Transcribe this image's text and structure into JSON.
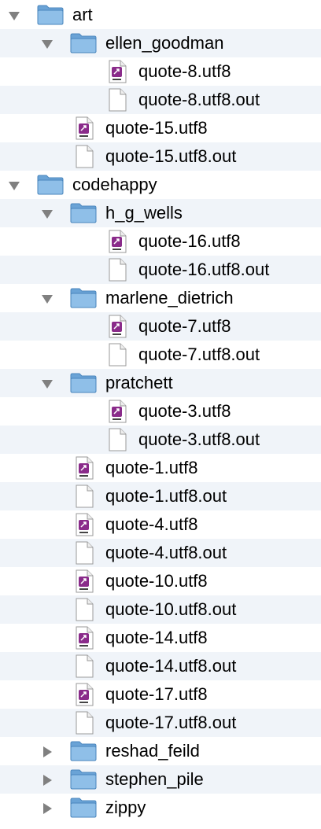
{
  "rows": [
    {
      "label": "art",
      "kind": "folder",
      "expanded": true,
      "depth": 0
    },
    {
      "label": "ellen_goodman",
      "kind": "folder",
      "expanded": true,
      "depth": 1
    },
    {
      "label": "quote-8.utf8",
      "kind": "text-file",
      "depth": 2
    },
    {
      "label": "quote-8.utf8.out",
      "kind": "blank-file",
      "depth": 2
    },
    {
      "label": "quote-15.utf8",
      "kind": "text-file",
      "depth": 1
    },
    {
      "label": "quote-15.utf8.out",
      "kind": "blank-file",
      "depth": 1
    },
    {
      "label": "codehappy",
      "kind": "folder",
      "expanded": true,
      "depth": 0
    },
    {
      "label": "h_g_wells",
      "kind": "folder",
      "expanded": true,
      "depth": 1
    },
    {
      "label": "quote-16.utf8",
      "kind": "text-file",
      "depth": 2
    },
    {
      "label": "quote-16.utf8.out",
      "kind": "blank-file",
      "depth": 2
    },
    {
      "label": "marlene_dietrich",
      "kind": "folder",
      "expanded": true,
      "depth": 1
    },
    {
      "label": "quote-7.utf8",
      "kind": "text-file",
      "depth": 2
    },
    {
      "label": "quote-7.utf8.out",
      "kind": "blank-file",
      "depth": 2
    },
    {
      "label": "pratchett",
      "kind": "folder",
      "expanded": true,
      "depth": 1
    },
    {
      "label": "quote-3.utf8",
      "kind": "text-file",
      "depth": 2
    },
    {
      "label": "quote-3.utf8.out",
      "kind": "blank-file",
      "depth": 2
    },
    {
      "label": "quote-1.utf8",
      "kind": "text-file",
      "depth": 1
    },
    {
      "label": "quote-1.utf8.out",
      "kind": "blank-file",
      "depth": 1
    },
    {
      "label": "quote-4.utf8",
      "kind": "text-file",
      "depth": 1
    },
    {
      "label": "quote-4.utf8.out",
      "kind": "blank-file",
      "depth": 1
    },
    {
      "label": "quote-10.utf8",
      "kind": "text-file",
      "depth": 1
    },
    {
      "label": "quote-10.utf8.out",
      "kind": "blank-file",
      "depth": 1
    },
    {
      "label": "quote-14.utf8",
      "kind": "text-file",
      "depth": 1
    },
    {
      "label": "quote-14.utf8.out",
      "kind": "blank-file",
      "depth": 1
    },
    {
      "label": "quote-17.utf8",
      "kind": "text-file",
      "depth": 1
    },
    {
      "label": "quote-17.utf8.out",
      "kind": "blank-file",
      "depth": 1
    },
    {
      "label": "reshad_feild",
      "kind": "folder",
      "expanded": false,
      "depth": 1
    },
    {
      "label": "stephen_pile",
      "kind": "folder",
      "expanded": false,
      "depth": 1
    },
    {
      "label": "zippy",
      "kind": "folder",
      "expanded": false,
      "depth": 1
    }
  ],
  "colors": {
    "row_alt": "#f0f4f9",
    "folder_body": "#8fbfe8",
    "folder_tab": "#6aa3d6",
    "text_icon_accent": "#8a2b8a",
    "triangle": "#808080"
  }
}
